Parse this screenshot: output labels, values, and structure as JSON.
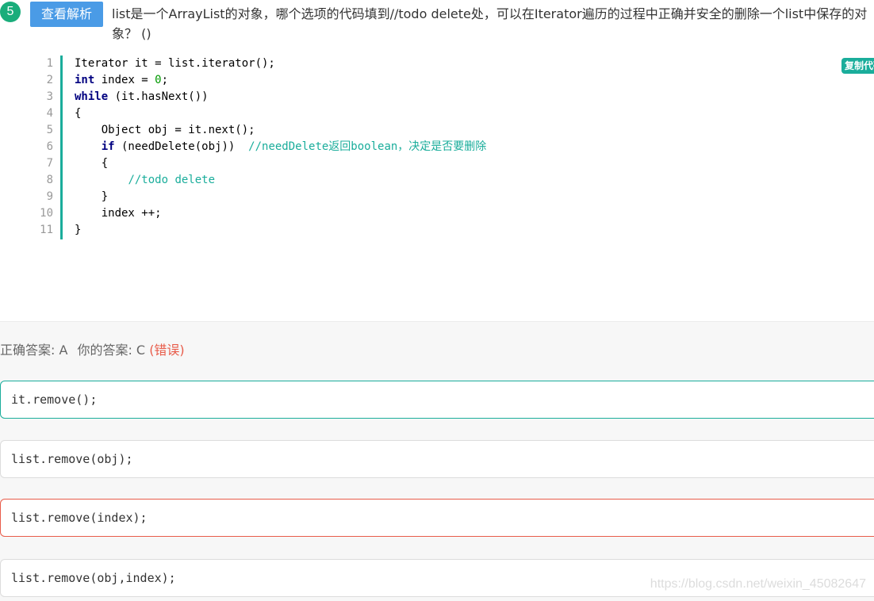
{
  "question": {
    "number": "5",
    "view_button": "查看解析",
    "text_line1": "list是一个ArrayList的对象，哪个选项的代码填到//todo delete处，可以在Iterator遍历的过程中正确并安全的删除一个list中保存的对",
    "text_line2": "象？ ()"
  },
  "code": {
    "copy_button": "复制代码",
    "line_numbers": [
      "1",
      "2",
      "3",
      "4",
      "5",
      "6",
      "7",
      "8",
      "9",
      "10",
      "11"
    ],
    "lines": [
      {
        "segments": [
          {
            "text": "Iterator it = list.iterator();",
            "style": "plain"
          }
        ]
      },
      {
        "segments": [
          {
            "text": "int",
            "style": "kw"
          },
          {
            "text": " index = ",
            "style": "plain"
          },
          {
            "text": "0",
            "style": "num"
          },
          {
            "text": ";",
            "style": "plain"
          }
        ]
      },
      {
        "segments": [
          {
            "text": "while",
            "style": "kw"
          },
          {
            "text": " (it.hasNext())",
            "style": "plain"
          }
        ]
      },
      {
        "segments": [
          {
            "text": "{",
            "style": "plain"
          }
        ]
      },
      {
        "segments": [
          {
            "text": "    Object obj = it.next();",
            "style": "plain"
          }
        ]
      },
      {
        "segments": [
          {
            "text": "    ",
            "style": "plain"
          },
          {
            "text": "if",
            "style": "kw"
          },
          {
            "text": " (needDelete(obj))  ",
            "style": "plain"
          },
          {
            "text": "//needDelete返回boolean，决定是否要删除",
            "style": "cm"
          }
        ]
      },
      {
        "segments": [
          {
            "text": "    {",
            "style": "plain"
          }
        ]
      },
      {
        "segments": [
          {
            "text": "        ",
            "style": "plain"
          },
          {
            "text": "//todo delete",
            "style": "cm"
          }
        ]
      },
      {
        "segments": [
          {
            "text": "    }",
            "style": "plain"
          }
        ]
      },
      {
        "segments": [
          {
            "text": "    index ++;",
            "style": "plain"
          }
        ]
      },
      {
        "segments": [
          {
            "text": "}",
            "style": "plain"
          }
        ]
      }
    ]
  },
  "answer": {
    "correct_label": "正确答案: A",
    "your_label": "你的答案: C",
    "status": "(错误)"
  },
  "options": [
    {
      "code": "it.remove();",
      "state": "correct"
    },
    {
      "code": "list.remove(obj);",
      "state": "normal"
    },
    {
      "code": "list.remove(index);",
      "state": "wrong"
    },
    {
      "code": "list.remove(obj,index);",
      "state": "normal"
    }
  ],
  "watermark": "https://blog.csdn.net/weixin_45082647",
  "colors": {
    "accent": "#1aad9b",
    "badge": "#1aad7b",
    "button": "#4a9be6",
    "error": "#e85c4a",
    "keyword": "#000080",
    "number": "#009900"
  }
}
